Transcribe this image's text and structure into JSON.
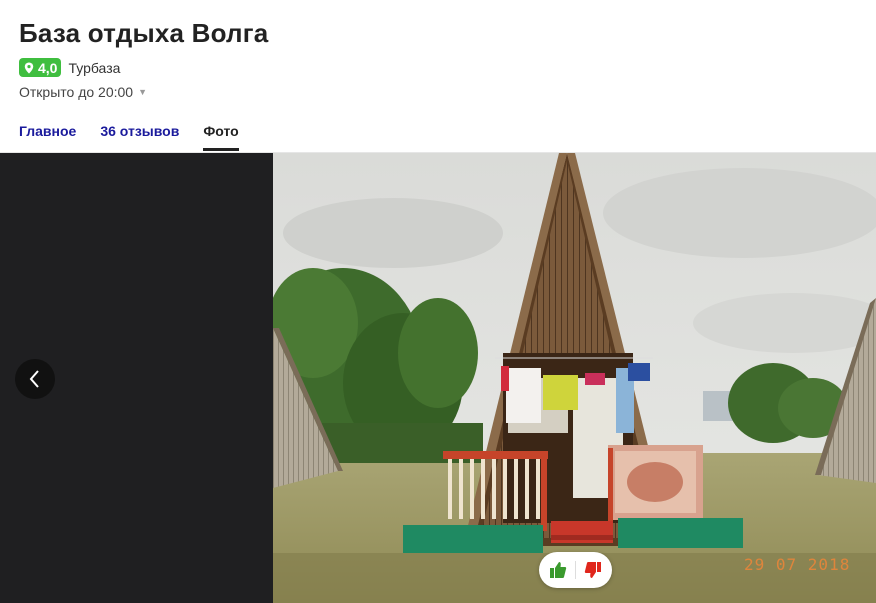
{
  "place": {
    "title": "База отдыха Волга",
    "rating": "4,0",
    "category": "Турбаза",
    "hours": "Открыто до 20:00"
  },
  "tabs": [
    {
      "label": "Главное",
      "active": false
    },
    {
      "label": "36 отзывов",
      "active": false
    },
    {
      "label": "Фото",
      "active": true
    }
  ],
  "gallery": {
    "photo_date_stamp": "29 07 2018"
  },
  "icons": {
    "rating": "pin-icon",
    "hours_toggle": "caret-down-icon",
    "prev": "chevron-left-icon",
    "like": "thumbs-up-icon",
    "dislike": "thumbs-down-icon"
  },
  "colors": {
    "rating_badge": "#3fbe3f",
    "tab_link": "#1a1a9c",
    "like": "#3a9a2e",
    "dislike": "#e0261c",
    "gallery_bg": "#1f1f21"
  }
}
